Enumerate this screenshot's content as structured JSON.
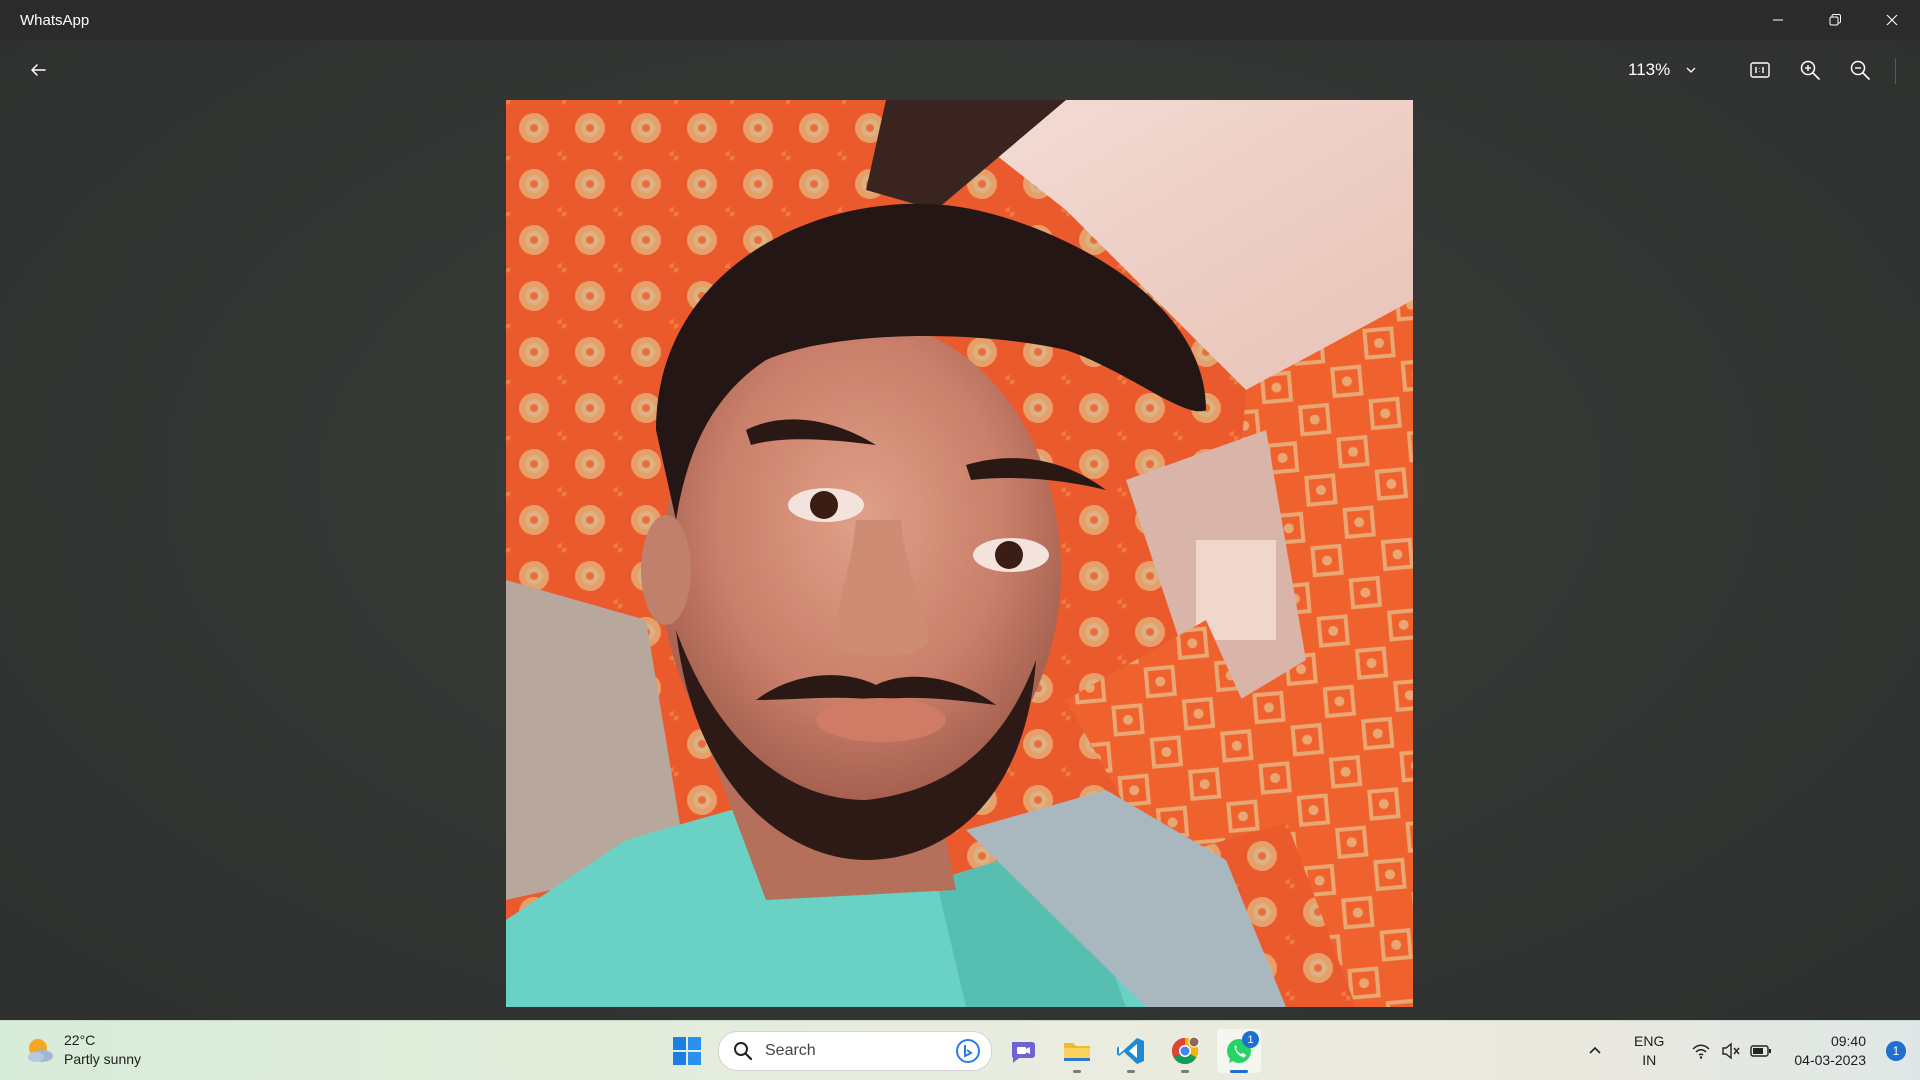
{
  "window": {
    "title": "WhatsApp"
  },
  "toolbar": {
    "zoom_level": "113%"
  },
  "photo": {
    "alt": "Profile photo"
  },
  "taskbar": {
    "weather": {
      "temperature": "22°C",
      "condition": "Partly sunny"
    },
    "search": {
      "placeholder": "Search"
    },
    "apps": [
      {
        "name": "Start"
      },
      {
        "name": "Teams Chat"
      },
      {
        "name": "File Explorer"
      },
      {
        "name": "Visual Studio Code"
      },
      {
        "name": "Google Chrome"
      },
      {
        "name": "WhatsApp",
        "badge": "1"
      }
    ],
    "language": {
      "line1": "ENG",
      "line2": "IN"
    },
    "clock": {
      "time": "09:40",
      "date": "04-03-2023"
    },
    "notifications": "1"
  },
  "colors": {
    "accent": "#1f6fd0",
    "titlebar": "#2b2b2b",
    "whatsapp": "#25d366"
  }
}
